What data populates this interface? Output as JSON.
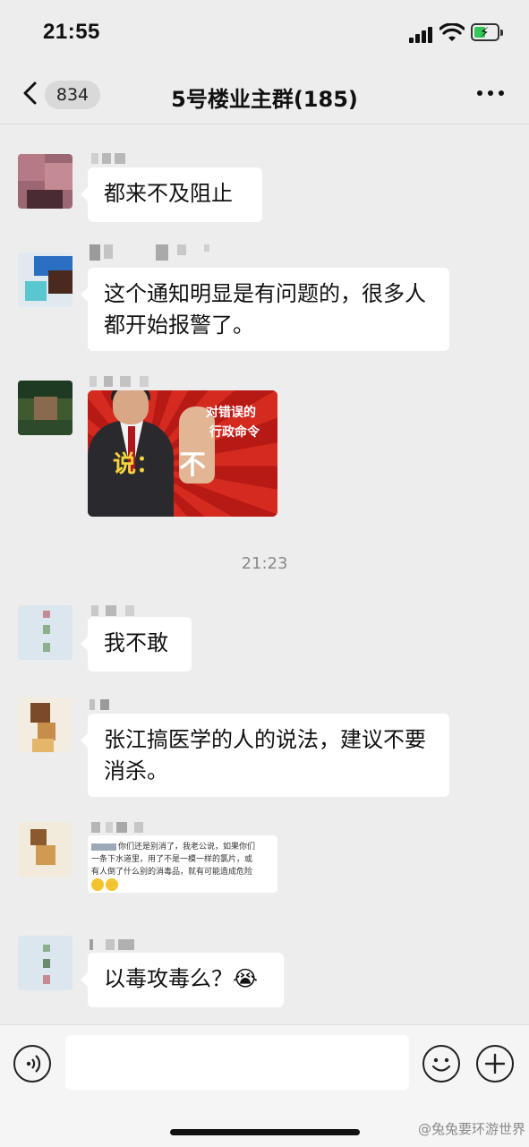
{
  "status_bar": {
    "time": "21:55"
  },
  "nav": {
    "unread_count": "834",
    "title": "5号楼业主群(185)"
  },
  "messages": [
    {
      "type": "text",
      "text": "都来不及阻止"
    },
    {
      "type": "text",
      "text": "这个通知明显是有问题的，很多人都开始报警了。"
    },
    {
      "type": "image",
      "lines": [
        "对错误的",
        "行政命令",
        "说：",
        "不"
      ]
    },
    {
      "type": "time",
      "text": "21:23"
    },
    {
      "type": "text",
      "text": "我不敢"
    },
    {
      "type": "text",
      "text": "张江搞医学的人的说法，建议不要消杀。"
    },
    {
      "type": "screenshot",
      "lines": [
        "你们还是别消了，我老公说，如果你们",
        "一条下水道里，用了不是一模一样的氯片，或",
        "有人倒了什么别的消毒品，就有可能造成危险"
      ]
    },
    {
      "type": "text",
      "text": "以毒攻毒么？",
      "emoji": "😭"
    }
  ],
  "input": {
    "placeholder": ""
  },
  "watermark": "@兔兔要环游世界",
  "icons": [
    "back-icon",
    "more-icon",
    "voice-icon",
    "emoji-icon",
    "plus-icon",
    "signal-icon",
    "wifi-icon",
    "battery-icon"
  ]
}
